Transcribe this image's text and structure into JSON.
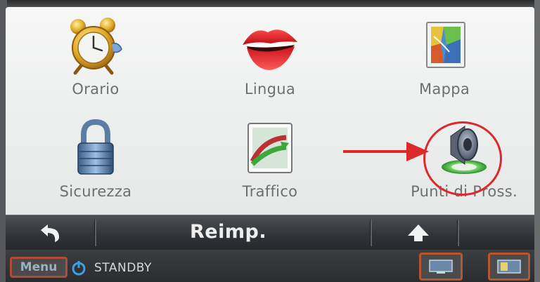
{
  "menu_items": [
    {
      "label": "Orario",
      "icon": "alarm-clock-icon"
    },
    {
      "label": "Lingua",
      "icon": "lips-icon"
    },
    {
      "label": "Mappa",
      "icon": "map-icon"
    },
    {
      "label": "Sicurezza",
      "icon": "padlock-icon"
    },
    {
      "label": "Traffico",
      "icon": "traffic-icon"
    },
    {
      "label": "Punti di Pross.",
      "icon": "speaker-icon"
    }
  ],
  "bottom_bar": {
    "title": "Reimp.",
    "back_icon": "back-arrow-icon",
    "up_icon": "up-arrow-icon"
  },
  "status_bar": {
    "menu_label": "Menu",
    "standby_label": "STANDBY"
  },
  "colors": {
    "annotation": "#dc2a2a",
    "accent_border": "#b8542e"
  }
}
